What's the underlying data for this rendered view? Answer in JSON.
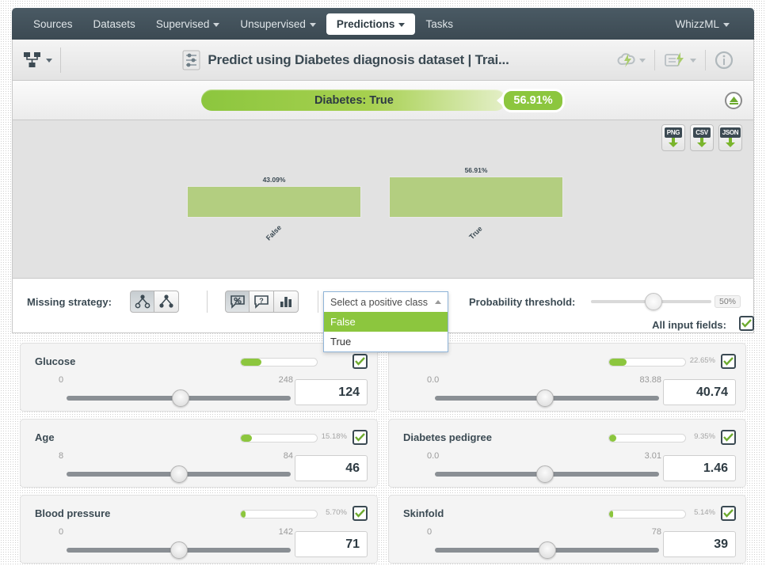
{
  "navbar": {
    "items": [
      {
        "label": "Sources",
        "caret": false,
        "active": false
      },
      {
        "label": "Datasets",
        "caret": false,
        "active": false
      },
      {
        "label": "Supervised",
        "caret": true,
        "active": false
      },
      {
        "label": "Unsupervised",
        "caret": true,
        "active": false
      },
      {
        "label": "Predictions",
        "caret": true,
        "active": true
      },
      {
        "label": "Tasks",
        "caret": false,
        "active": false
      }
    ],
    "right": {
      "label": "WhizzML",
      "caret": true
    }
  },
  "header": {
    "title": "Predict using Diabetes diagnosis dataset | Trai...",
    "model_icon": "model-tree-icon",
    "title_icon": "sliders-icon",
    "actions": [
      {
        "name": "cloud-lightning-icon"
      },
      {
        "name": "script-lightning-icon"
      },
      {
        "name": "info-icon"
      }
    ]
  },
  "prediction": {
    "label": "Diabetes: True",
    "confidence": "56.91%",
    "collapse_icon": "collapse-up-icon",
    "accent_color": "#8cc63e"
  },
  "exports": [
    {
      "label": "PNG",
      "name": "export-png-button"
    },
    {
      "label": "CSV",
      "name": "export-csv-button"
    },
    {
      "label": "JSON",
      "name": "export-json-button"
    }
  ],
  "chart_data": {
    "type": "bar",
    "title": "",
    "categories": [
      "False",
      "True"
    ],
    "values": [
      43.09,
      56.91
    ],
    "value_labels": [
      "43.09%",
      "56.91%"
    ],
    "xlabel": "",
    "ylabel": "",
    "ylim": [
      0,
      100
    ],
    "grid": false,
    "legend": "none",
    "bar_color": "#b3ce80",
    "background": "#e2e2e2"
  },
  "controls": {
    "missing_strategy_label": "Missing strategy:",
    "missing_buttons": [
      {
        "name": "missing-last-prediction-icon",
        "active": true
      },
      {
        "name": "missing-proportional-icon",
        "active": false
      }
    ],
    "view_buttons": [
      {
        "name": "percent-bubble-icon",
        "active": true
      },
      {
        "name": "question-bubble-icon",
        "active": false
      },
      {
        "name": "histogram-icon",
        "active": false
      }
    ],
    "positive_class": {
      "placeholder": "Select a positive class",
      "expanded": true,
      "options": [
        "False",
        "True"
      ],
      "highlighted": "False"
    },
    "threshold_label": "Probability threshold:",
    "threshold_value": "50%",
    "threshold_percent": 50,
    "all_input_fields_label": "All input fields:",
    "all_input_fields_checked": true
  },
  "fields": [
    {
      "name": "Glucose",
      "importance": "",
      "importance_pct": 26.5,
      "min": "0",
      "max": "248",
      "value": "124",
      "knob_percent": 50,
      "checked": true,
      "label_hidden_by_dropdown": false
    },
    {
      "name": "",
      "importance": "22.65%",
      "importance_pct": 22.65,
      "min": "0.0",
      "max": "83.88",
      "value": "40.74",
      "knob_percent": 49,
      "checked": true,
      "label_hidden_by_dropdown": true
    },
    {
      "name": "Age",
      "importance": "15.18%",
      "importance_pct": 15.18,
      "min": "8",
      "max": "84",
      "value": "46",
      "knob_percent": 50,
      "checked": true,
      "label_hidden_by_dropdown": false
    },
    {
      "name": "Diabetes pedigree",
      "importance": "9.35%",
      "importance_pct": 9.35,
      "min": "0.0",
      "max": "3.01",
      "value": "1.46",
      "knob_percent": 49,
      "checked": true,
      "label_hidden_by_dropdown": false
    },
    {
      "name": "Blood pressure",
      "importance": "5.70%",
      "importance_pct": 5.7,
      "min": "0",
      "max": "142",
      "value": "71",
      "knob_percent": 50,
      "checked": true,
      "label_hidden_by_dropdown": false
    },
    {
      "name": "Skinfold",
      "importance": "5.14%",
      "importance_pct": 5.14,
      "min": "0",
      "max": "78",
      "value": "39",
      "knob_percent": 50,
      "checked": true,
      "label_hidden_by_dropdown": false
    }
  ]
}
